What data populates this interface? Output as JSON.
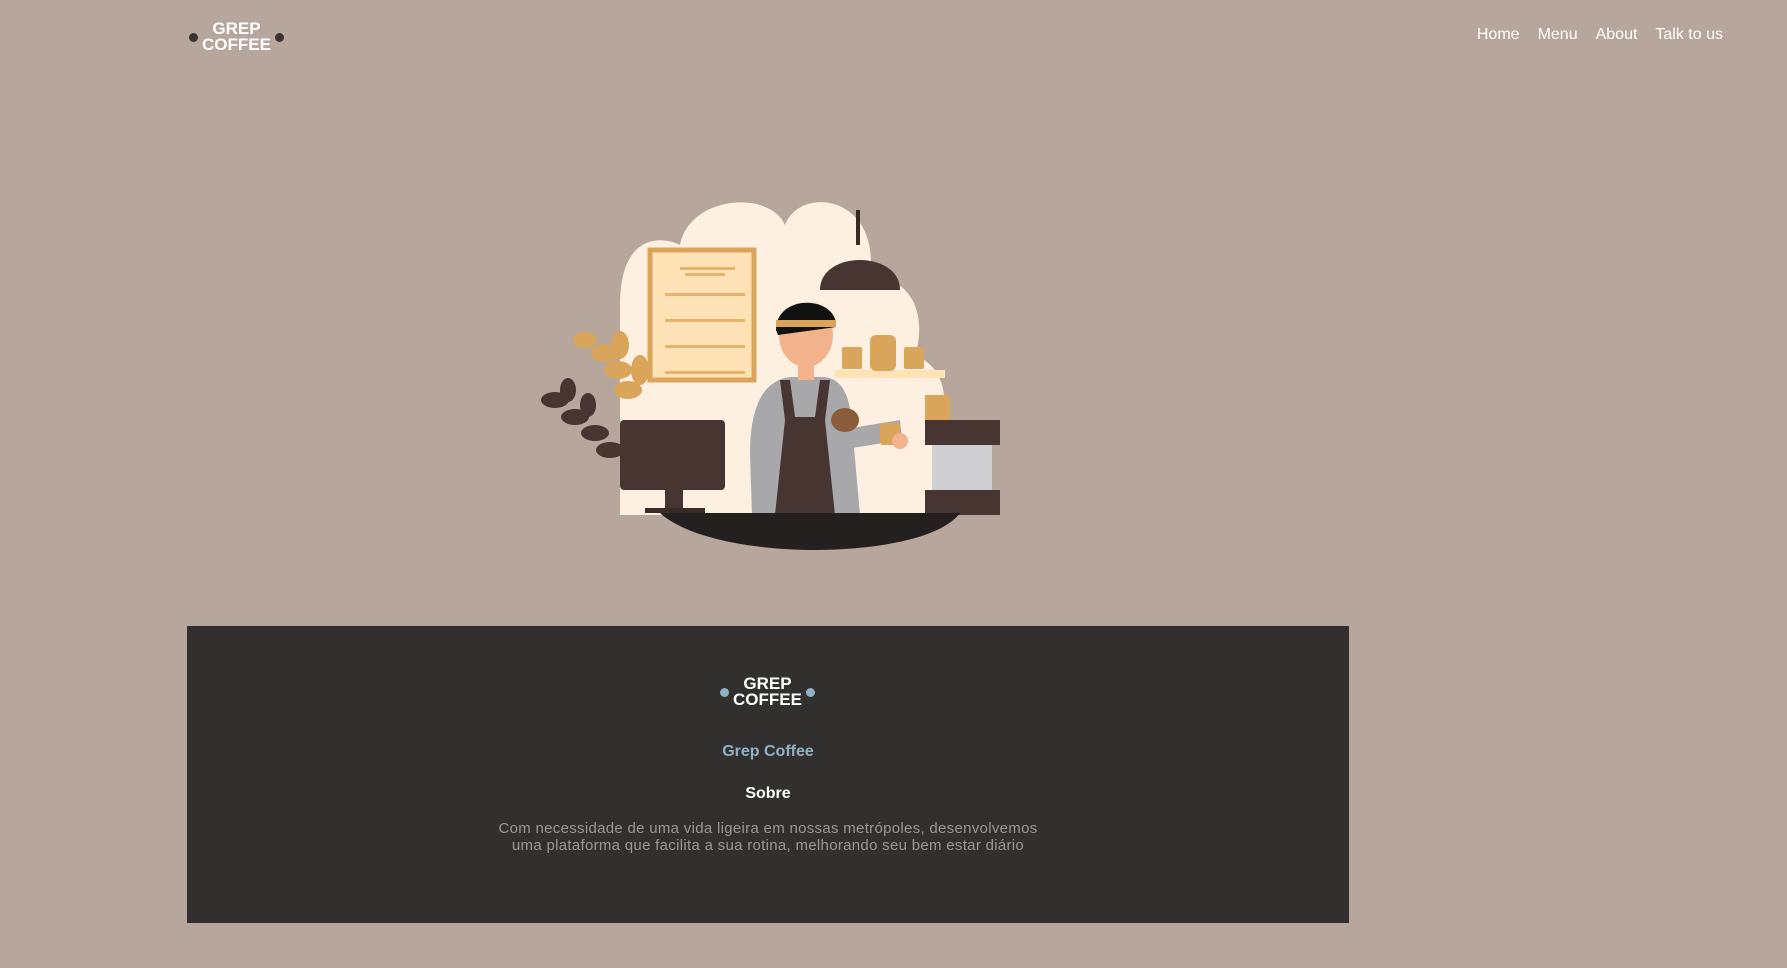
{
  "header": {
    "logo": {
      "line1": "GREP",
      "line2": "COFFEE"
    },
    "nav": [
      "Home",
      "Menu",
      "About",
      "Talk to us"
    ]
  },
  "hero": {
    "illustration": "barista-illustration"
  },
  "footer": {
    "logo": {
      "line1": "GREP",
      "line2": "COFFEE"
    },
    "brand": "Grep Coffee",
    "heading": "Sobre",
    "text_line1": "Com necessidade de uma vida ligeira em nossas metrópoles, desenvolvemos",
    "text_line2": "uma plataforma que facilita a sua rotina, melhorando seu bem estar diário"
  },
  "colors": {
    "background": "#b7a69b",
    "footer_bg": "#32302f",
    "accent": "#8fb3c2",
    "cream": "#fdf0e0",
    "dark_brown": "#463530",
    "gold": "#d9a55a"
  }
}
